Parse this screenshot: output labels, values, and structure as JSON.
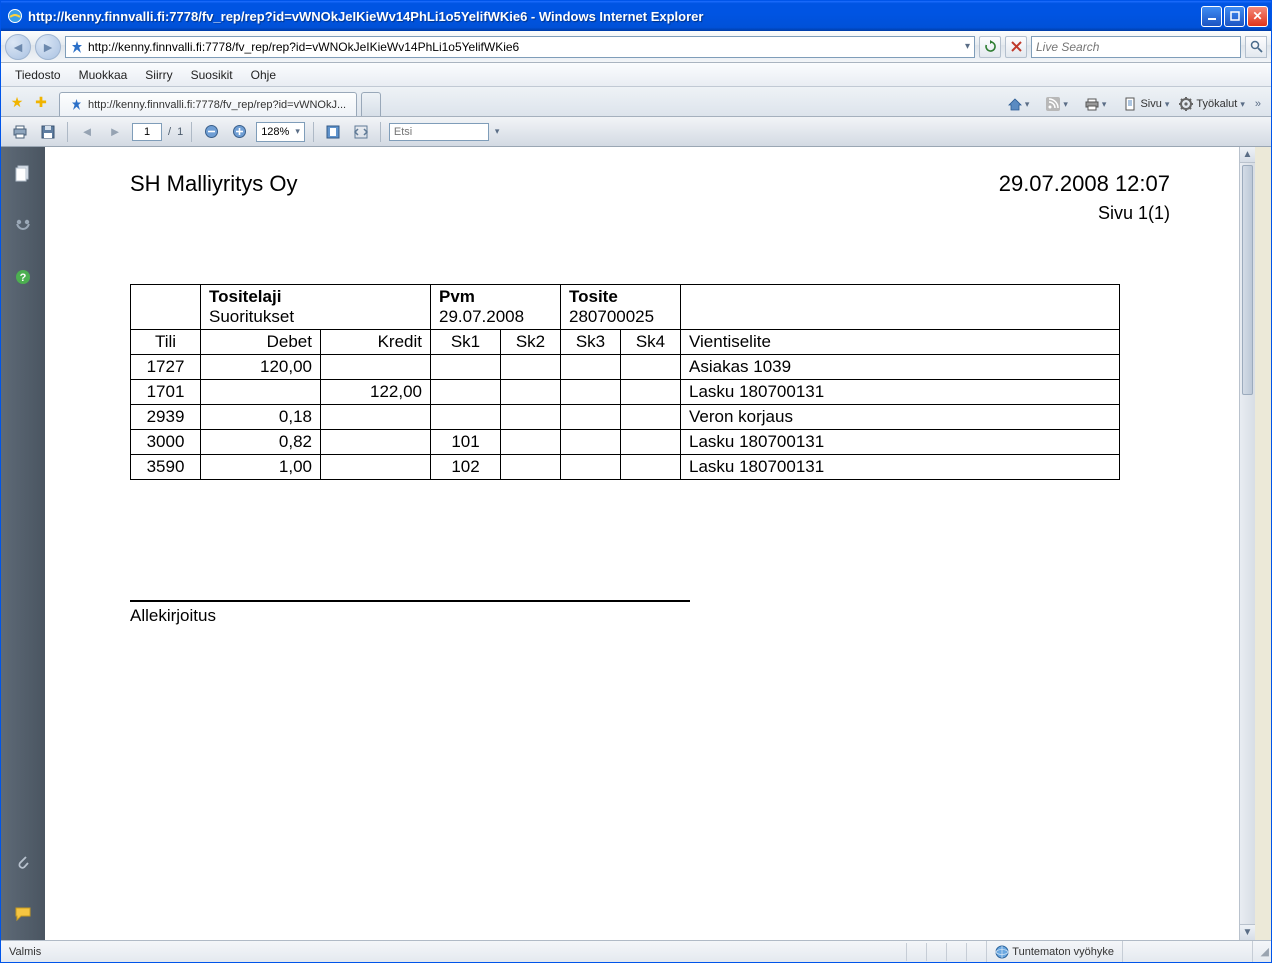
{
  "window": {
    "title": "http://kenny.finnvalli.fi:7778/fv_rep/rep?id=vWNOkJeIKieWv14PhLi1o5YelifWKie6 - Windows Internet Explorer"
  },
  "address": {
    "url": "http://kenny.finnvalli.fi:7778/fv_rep/rep?id=vWNOkJeIKieWv14PhLi1o5YelifWKie6"
  },
  "search": {
    "placeholder": "Live Search"
  },
  "menus": {
    "file": "Tiedosto",
    "edit": "Muokkaa",
    "go": "Siirry",
    "favorites": "Suosikit",
    "help": "Ohje"
  },
  "tab": {
    "label": "http://kenny.finnvalli.fi:7778/fv_rep/rep?id=vWNOkJ..."
  },
  "tabtools": {
    "page": "Sivu",
    "tools": "Työkalut"
  },
  "pdf": {
    "page_current": "1",
    "page_total": "1",
    "zoom": "128%",
    "find_placeholder": "Etsi"
  },
  "report": {
    "company": "SH Malliyritys Oy",
    "datetime": "29.07.2008 12:07",
    "page_label": "Sivu 1(1)",
    "hdr": {
      "tositelaji_label": "Tositelaji",
      "tositelaji_value": "Suoritukset",
      "pvm_label": "Pvm",
      "pvm_value": "29.07.2008",
      "tosite_label": "Tosite",
      "tosite_value": "280700025"
    },
    "cols": {
      "tili": "Tili",
      "debet": "Debet",
      "kredit": "Kredit",
      "sk1": "Sk1",
      "sk2": "Sk2",
      "sk3": "Sk3",
      "sk4": "Sk4",
      "selite": "Vientiselite"
    },
    "rows": [
      {
        "tili": "1727",
        "debet": "120,00",
        "kredit": "",
        "sk1": "",
        "sk2": "",
        "sk3": "",
        "sk4": "",
        "selite": "Asiakas 1039"
      },
      {
        "tili": "1701",
        "debet": "",
        "kredit": "122,00",
        "sk1": "",
        "sk2": "",
        "sk3": "",
        "sk4": "",
        "selite": "Lasku 180700131"
      },
      {
        "tili": "2939",
        "debet": "0,18",
        "kredit": "",
        "sk1": "",
        "sk2": "",
        "sk3": "",
        "sk4": "",
        "selite": "Veron korjaus"
      },
      {
        "tili": "3000",
        "debet": "0,82",
        "kredit": "",
        "sk1": "101",
        "sk2": "",
        "sk3": "",
        "sk4": "",
        "selite": "Lasku 180700131"
      },
      {
        "tili": "3590",
        "debet": "1,00",
        "kredit": "",
        "sk1": "102",
        "sk2": "",
        "sk3": "",
        "sk4": "",
        "selite": "Lasku 180700131"
      }
    ],
    "signature": "Allekirjoitus"
  },
  "status": {
    "left": "Valmis",
    "zone": "Tuntematon vyöhyke"
  }
}
